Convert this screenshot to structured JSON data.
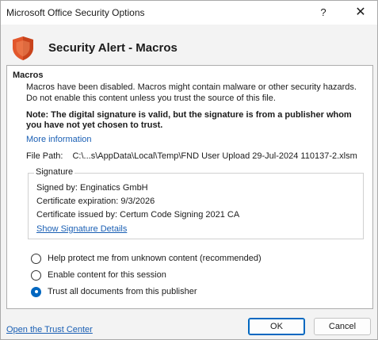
{
  "window": {
    "title": "Microsoft Office Security Options",
    "help_glyph": "?",
    "close_glyph": "✕"
  },
  "header": {
    "icon": "shield-icon",
    "title": "Security Alert - Macros",
    "icon_color": "#e2572c"
  },
  "macros": {
    "section_title": "Macros",
    "description": "Macros have been disabled. Macros might contain malware or other security hazards. Do not enable this content unless you trust the source of this file.",
    "note": "Note: The digital signature is valid, but the signature is from a publisher whom you have not yet chosen to trust.",
    "more_information_link": "More information",
    "file_path_label": "File Path:",
    "file_path_value": "C:\\...s\\AppData\\Local\\Temp\\FND User Upload 29-Jul-2024 110137-2.xlsm"
  },
  "signature": {
    "legend": "Signature",
    "signed_by": "Signed by: Enginatics GmbH",
    "expiration": "Certificate expiration: 9/3/2026",
    "issued_by": "Certificate issued by: Certum Code Signing 2021 CA",
    "details_link": "Show Signature Details"
  },
  "options": [
    {
      "label": "Help protect me from unknown content (recommended)",
      "checked": false
    },
    {
      "label": "Enable content for this session",
      "checked": false
    },
    {
      "label": "Trust all documents from this publisher",
      "checked": true
    }
  ],
  "footer": {
    "trust_center_link": "Open the Trust Center",
    "ok_label": "OK",
    "cancel_label": "Cancel"
  }
}
